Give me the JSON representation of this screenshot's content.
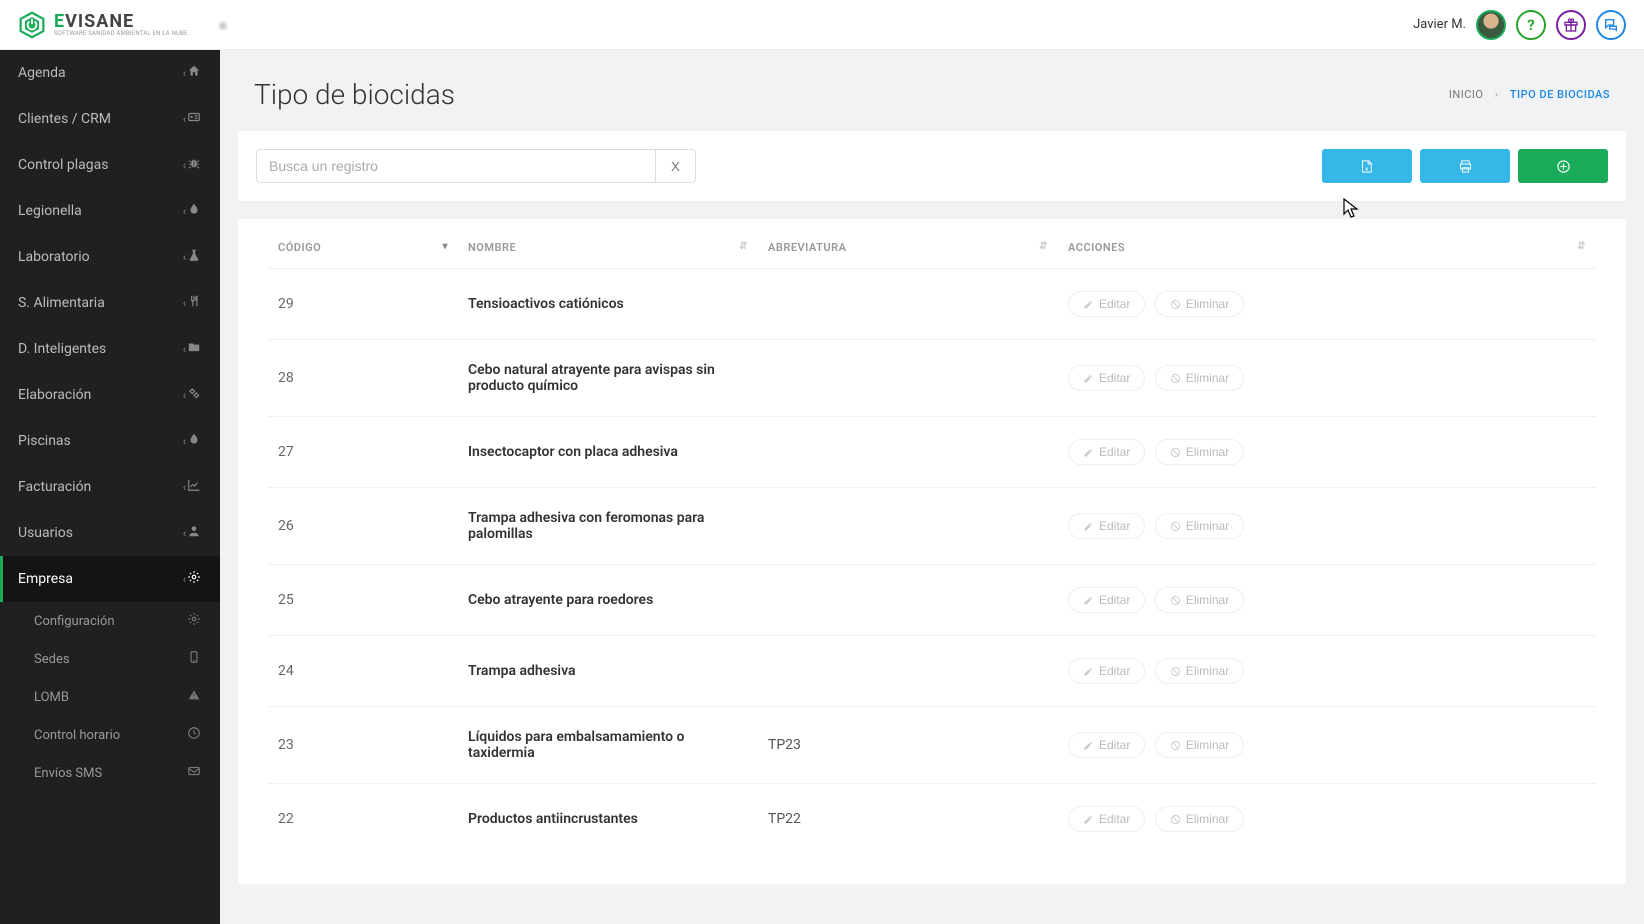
{
  "brand": {
    "name_prefix": "E",
    "name_rest": "VISANE",
    "subtitle": "SOFTWARE SANIDAD AMBIENTAL EN LA NUBE"
  },
  "user": {
    "name": "Javier M."
  },
  "sidebar": {
    "items": [
      {
        "label": "Agenda",
        "icon": "home"
      },
      {
        "label": "Clientes / CRM",
        "icon": "card"
      },
      {
        "label": "Control plagas",
        "icon": "bug"
      },
      {
        "label": "Legionella",
        "icon": "drop"
      },
      {
        "label": "Laboratorio",
        "icon": "flask"
      },
      {
        "label": "S. Alimentaria",
        "icon": "food"
      },
      {
        "label": "D. Inteligentes",
        "icon": "folder"
      },
      {
        "label": "Elaboración",
        "icon": "gears"
      },
      {
        "label": "Piscinas",
        "icon": "drop"
      },
      {
        "label": "Facturación",
        "icon": "chart"
      },
      {
        "label": "Usuarios",
        "icon": "user"
      },
      {
        "label": "Empresa",
        "icon": "gear",
        "active": true
      }
    ],
    "sub_items": [
      {
        "label": "Configuración",
        "icon": "gear"
      },
      {
        "label": "Sedes",
        "icon": "tablet"
      },
      {
        "label": "LOMB",
        "icon": "alert"
      },
      {
        "label": "Control horario",
        "icon": "clock"
      },
      {
        "label": "Envíos SMS",
        "icon": "mail"
      }
    ]
  },
  "page": {
    "title": "Tipo de biocidas",
    "breadcrumb": {
      "home": "INICIO",
      "current": "TIPO DE BIOCIDAS"
    },
    "search_placeholder": "Busca un registro",
    "clear_label": "X"
  },
  "table": {
    "headers": {
      "code": "CÓDIGO",
      "name": "NOMBRE",
      "abbr": "ABREVIATURA",
      "actions": "ACCIONES"
    },
    "edit_label": "Editar",
    "delete_label": "Eliminar",
    "rows": [
      {
        "code": "29",
        "name": "Tensioactivos catiónicos",
        "abbr": ""
      },
      {
        "code": "28",
        "name": "Cebo natural atrayente para avispas sin producto químico",
        "abbr": ""
      },
      {
        "code": "27",
        "name": "Insectocaptor con placa adhesiva",
        "abbr": ""
      },
      {
        "code": "26",
        "name": "Trampa adhesiva con feromonas para palomillas",
        "abbr": ""
      },
      {
        "code": "25",
        "name": "Cebo atrayente para roedores",
        "abbr": ""
      },
      {
        "code": "24",
        "name": "Trampa adhesiva",
        "abbr": ""
      },
      {
        "code": "23",
        "name": "Líquidos para embalsamamiento o taxidermia",
        "abbr": "TP23"
      },
      {
        "code": "22",
        "name": "Productos antiincrustantes",
        "abbr": "TP22"
      }
    ]
  }
}
